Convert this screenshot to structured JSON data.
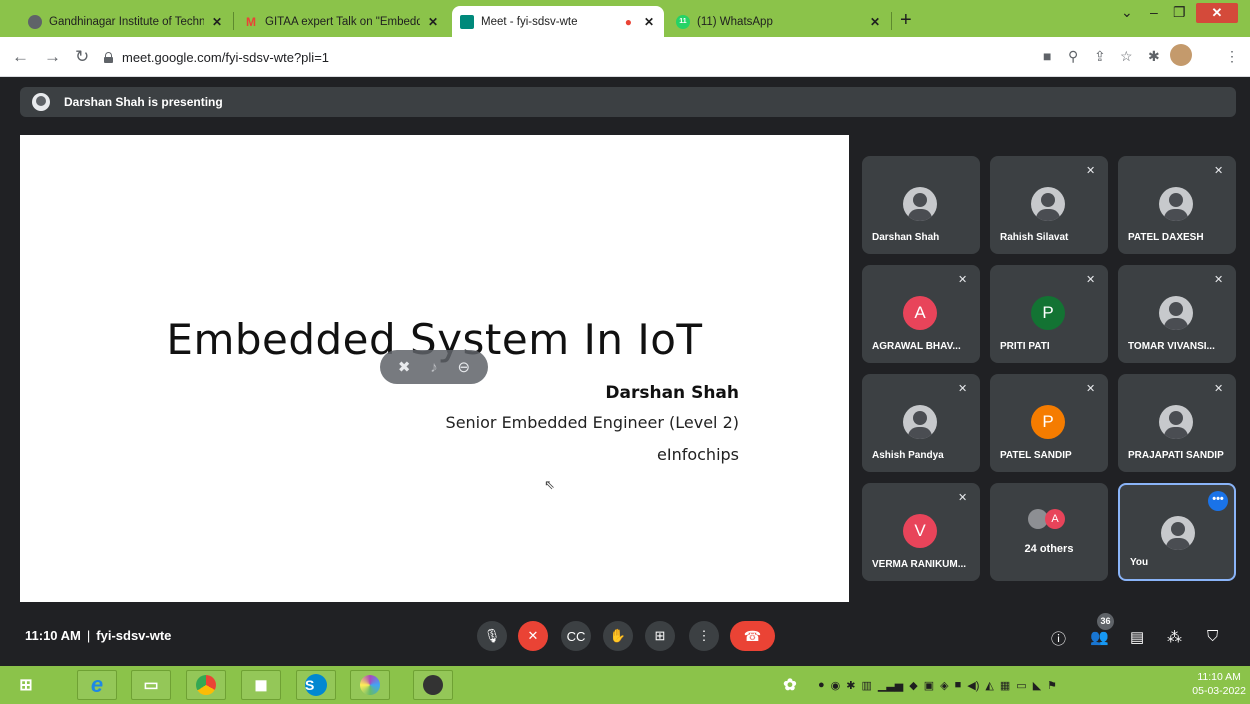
{
  "browser": {
    "tabs": [
      {
        "title": "Gandhinagar Institute of Technolo",
        "favicon_color": "#5f6368"
      },
      {
        "title": "GITAA expert Talk on \"Embedded",
        "favicon_color": "#ea4335",
        "favicon_text": "M"
      },
      {
        "title": "Meet - fyi-sdsv-wte",
        "favicon_color": "#00897b",
        "active": true
      },
      {
        "title": "(11) WhatsApp",
        "favicon_color": "#25d366",
        "favicon_text": "11"
      }
    ],
    "url": "meet.google.com/fyi-sdsv-wte?pli=1"
  },
  "meet": {
    "presenting_banner": "Darshan Shah is presenting",
    "slide": {
      "title": "Embedded System In IoT",
      "presenter_name": "Darshan Shah",
      "presenter_role": "Senior Embedded Engineer (Level 2)",
      "company": "eInfochips"
    },
    "participants": [
      {
        "name": "Darshan Shah",
        "avatar": "photo",
        "muted": false
      },
      {
        "name": "Rahish Silavat",
        "avatar": "photo",
        "muted": true
      },
      {
        "name": "PATEL DAXESH",
        "avatar": "photo",
        "muted": true
      },
      {
        "name": "AGRAWAL BHAV...",
        "avatar": "letter",
        "letter": "A",
        "color": "#e8445a",
        "muted": true
      },
      {
        "name": "PRITI PATI",
        "avatar": "letter",
        "letter": "P",
        "color": "#137333",
        "muted": true
      },
      {
        "name": "TOMAR VIVANSI...",
        "avatar": "photo",
        "muted": true
      },
      {
        "name": "Ashish Pandya",
        "avatar": "photo",
        "muted": true
      },
      {
        "name": "PATEL SANDIP",
        "avatar": "letter",
        "letter": "P",
        "color": "#f57c00",
        "muted": true
      },
      {
        "name": "PRAJAPATI SANDIP",
        "avatar": "photo",
        "muted": true
      },
      {
        "name": "VERMA RANIKUM...",
        "avatar": "letter",
        "letter": "V",
        "color": "#e8445a",
        "muted": true
      }
    ],
    "others_label": "24 others",
    "others_letter": "A",
    "you_label": "You",
    "time": "11:10 AM",
    "separator": "|",
    "meeting_code": "fyi-sdsv-wte",
    "people_count": "36"
  },
  "taskbar": {
    "clock_time": "11:10 AM",
    "clock_date": "05-03-2022"
  }
}
